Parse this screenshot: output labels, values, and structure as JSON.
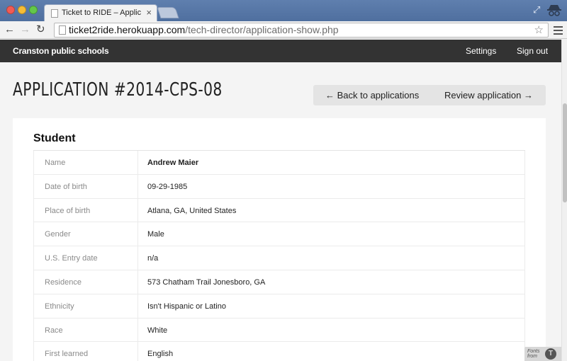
{
  "browser": {
    "tab_title": "Ticket to RIDE – Application #",
    "tab_close": "×",
    "url_host": "ticket2ride.herokuapp.com",
    "url_path": "/tech-director/application-show.php",
    "back_glyph": "←",
    "forward_glyph": "→",
    "reload_glyph": "↻",
    "star_glyph": "☆",
    "restore_glyph": "⤢"
  },
  "header": {
    "brand": "Cranston public schools",
    "nav": {
      "settings": "Settings",
      "signout": "Sign out"
    }
  },
  "page": {
    "title": "APPLICATION #2014-CPS-08",
    "actions": {
      "back": "← Back to applications",
      "review": "Review application →"
    }
  },
  "student": {
    "section_title": "Student",
    "rows": [
      {
        "label": "Name",
        "value": "Andrew Maier"
      },
      {
        "label": "Date of birth",
        "value": "09-29-1985"
      },
      {
        "label": "Place of birth",
        "value": "Atlana, GA, United States"
      },
      {
        "label": "Gender",
        "value": "Male"
      },
      {
        "label": "U.S. Entry date",
        "value": "n/a"
      },
      {
        "label": "Residence",
        "value": "573 Chatham Trail Jonesboro, GA"
      },
      {
        "label": "Ethnicity",
        "value": "Isn't Hispanic or Latino"
      },
      {
        "label": "Race",
        "value": "White"
      },
      {
        "label": "First learned",
        "value": "English"
      }
    ]
  },
  "badge": {
    "text": "Fonts from",
    "logo": "T"
  }
}
